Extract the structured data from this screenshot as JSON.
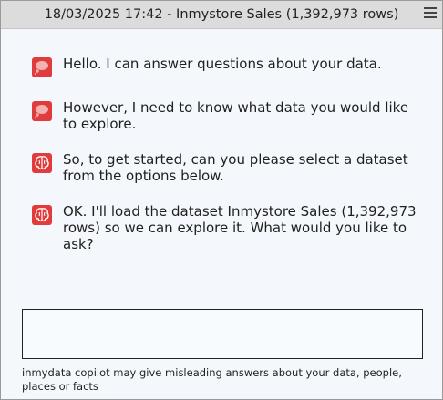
{
  "window": {
    "title": "18/03/2025 17:42 - Inmystore Sales (1,392,973 rows)"
  },
  "menu_icon": "hamburger-menu-icon",
  "accent_color": "#e03c3c",
  "messages": [
    {
      "icon": "thought-bubble-icon",
      "text": "Hello. I can answer questions about your data."
    },
    {
      "icon": "thought-bubble-icon",
      "text": "However, I need to know what data you would like to explore."
    },
    {
      "icon": "brain-icon",
      "text": "So, to get started, can you please select a dataset from the options below."
    },
    {
      "icon": "brain-icon",
      "text": "OK. I'll load the dataset Inmystore Sales (1,392,973 rows) so we can explore it. What would you like to ask?"
    }
  ],
  "input": {
    "value": "",
    "placeholder": ""
  },
  "disclaimer": "inmydata copilot may give misleading answers about your data, people, places or facts"
}
